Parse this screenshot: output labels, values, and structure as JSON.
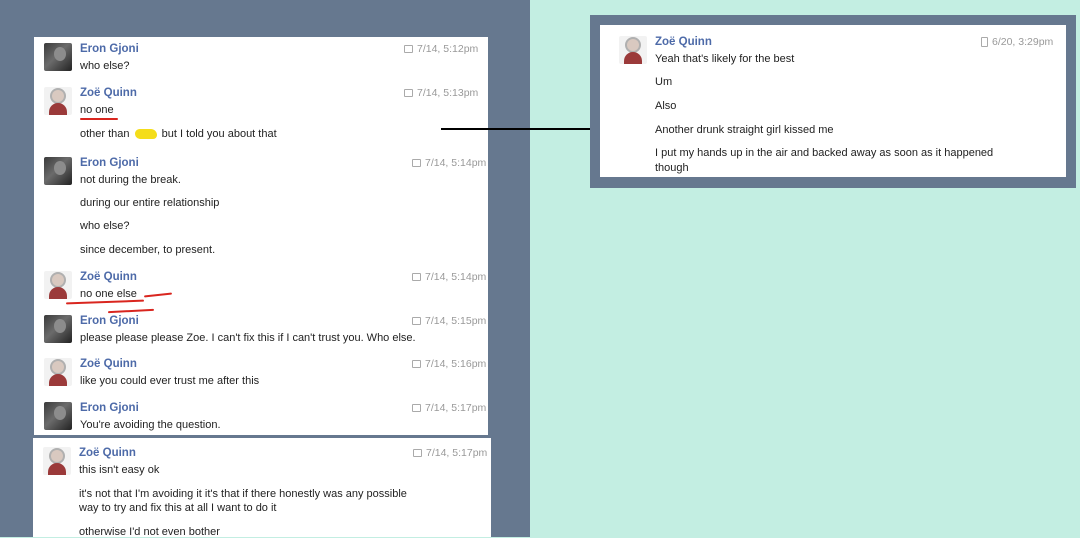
{
  "left_chat": {
    "block1": {
      "m1": {
        "name": "Eron Gjoni",
        "time": "7/14, 5:12pm",
        "lines": [
          "who else?"
        ]
      },
      "m2": {
        "name": "Zoë Quinn",
        "time": "7/14, 5:13pm",
        "lines": [
          "no one",
          "other than",
          "but I told you about that"
        ]
      },
      "m3": {
        "name": "Eron Gjoni",
        "time": "7/14, 5:14pm",
        "lines": [
          "not during the break.",
          "during our entire relationship",
          "who else?",
          "since december, to present."
        ]
      },
      "m4": {
        "name": "Zoë Quinn",
        "time": "7/14, 5:14pm",
        "lines": [
          "no one else"
        ]
      },
      "m5": {
        "name": "Eron Gjoni",
        "time": "7/14, 5:15pm",
        "lines": [
          "please please please Zoe. I can't fix this if I can't trust you. Who else."
        ]
      },
      "m6": {
        "name": "Zoë Quinn",
        "time": "7/14, 5:16pm",
        "lines": [
          "like you could ever trust me after this"
        ]
      },
      "m7": {
        "name": "Eron Gjoni",
        "time": "7/14, 5:17pm",
        "lines": [
          "You're avoiding the question."
        ]
      }
    },
    "block2": {
      "m8": {
        "name": "Zoë Quinn",
        "time": "7/14, 5:17pm",
        "lines": [
          "this isn't easy ok",
          "it's not that I'm avoiding it it's that if there honestly was any possible",
          "way to try and fix this at all I want to do it",
          "otherwise I'd not even bother"
        ]
      }
    }
  },
  "right_chat": {
    "m1": {
      "name": "Zoë Quinn",
      "time": "6/20, 3:29pm",
      "lines": [
        "Yeah that's likely for the best",
        "Um",
        "Also",
        "Another drunk straight girl kissed me",
        "I put my hands up in the air and backed away as soon as it happened",
        "though"
      ]
    }
  },
  "icons": {
    "message": "message-icon",
    "phone": "phone-icon"
  },
  "colors": {
    "left_background": "#66788f",
    "right_background": "#c3eee2",
    "name_color": "#4d6aa8",
    "underline_red": "#d9261f",
    "redaction_yellow": "#f4dd1a"
  }
}
